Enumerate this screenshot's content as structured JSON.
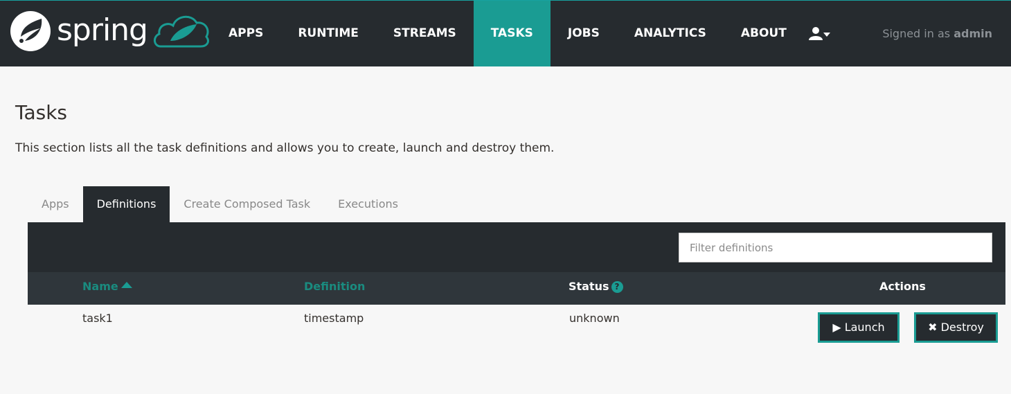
{
  "brand": {
    "name": "spring"
  },
  "nav": {
    "items": [
      "APPS",
      "RUNTIME",
      "STREAMS",
      "TASKS",
      "JOBS",
      "ANALYTICS",
      "ABOUT"
    ],
    "active": "TASKS"
  },
  "user": {
    "signed_in_prefix": "Signed in as",
    "username": "admin"
  },
  "page": {
    "title": "Tasks",
    "description": "This section lists all the task definitions and allows you to create, launch and destroy them."
  },
  "tabs": [
    "Apps",
    "Definitions",
    "Create Composed Task",
    "Executions"
  ],
  "active_tab": "Definitions",
  "filter": {
    "placeholder": "Filter definitions",
    "value": ""
  },
  "table": {
    "columns": {
      "name": "Name",
      "definition": "Definition",
      "status": "Status",
      "actions": "Actions"
    },
    "sort": {
      "column": "Name",
      "direction": "ascending"
    },
    "rows": [
      {
        "name": "task1",
        "definition": "timestamp",
        "status": "unknown"
      }
    ],
    "actions": {
      "launch": "Launch",
      "destroy": "Destroy"
    }
  },
  "icons": [
    "spring-logo-icon",
    "cloud-icon",
    "user-icon",
    "caret-down-icon",
    "sort-up-icon",
    "help-icon",
    "play-icon",
    "close-icon"
  ],
  "colors": {
    "header_bg": "#262b2f",
    "accent": "#1a9c93",
    "page_bg": "#f7f7f7",
    "sortable_header": "#1a8b7f"
  }
}
